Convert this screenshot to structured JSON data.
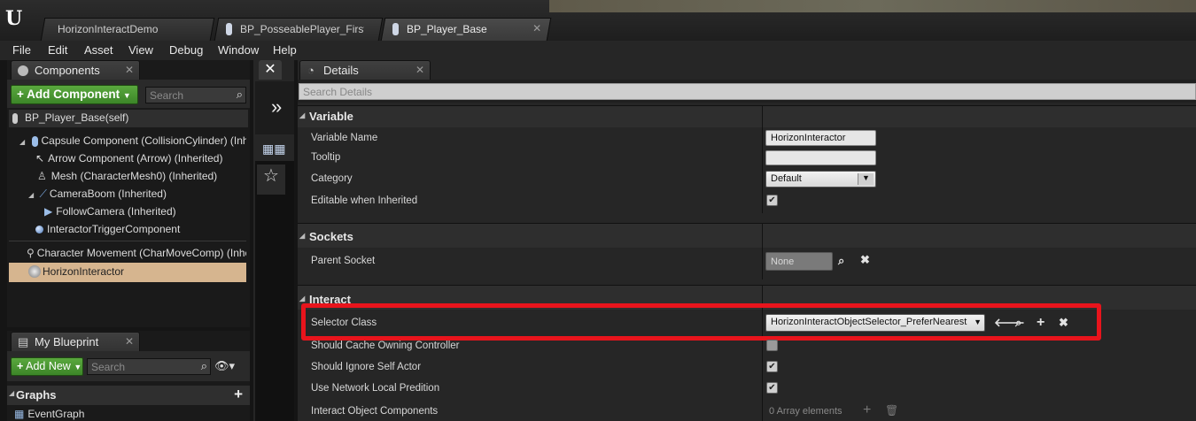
{
  "tabs": [
    {
      "label": "HorizonInteractDemo",
      "close": "✕"
    },
    {
      "label": "BP_PosseablePlayer_First",
      "close": "✕"
    },
    {
      "label": "BP_Player_Base",
      "close": "✕"
    }
  ],
  "menu": [
    "File",
    "Edit",
    "Asset",
    "View",
    "Debug",
    "Window",
    "Help"
  ],
  "components_panel": {
    "title": "Components",
    "close": "✕",
    "add_button": "Add Component",
    "search_placeholder": "Search",
    "self_label": "BP_Player_Base(self)",
    "items": [
      "Capsule Component (CollisionCylinder) (Inherited)",
      "Arrow Component (Arrow) (Inherited)",
      "Mesh (CharacterMesh0) (Inherited)",
      "CameraBoom (Inherited)",
      "FollowCamera (Inherited)",
      "InteractorTriggerComponent",
      "Character Movement (CharMoveComp) (Inherited)",
      "HorizonInteractor"
    ]
  },
  "blueprint_panel": {
    "title": "My Blueprint",
    "close": "✕",
    "add_button": "Add New",
    "search_placeholder": "Search",
    "graphs_label": "Graphs",
    "graph_item": "EventGraph"
  },
  "details": {
    "title": "Details",
    "close": "✕",
    "search_placeholder": "Search Details",
    "sections": {
      "variable": "Variable",
      "sockets": "Sockets",
      "interact": "Interact"
    },
    "variable_name_label": "Variable Name",
    "variable_name_value": "HorizonInteractor",
    "tooltip_label": "Tooltip",
    "tooltip_value": "",
    "category_label": "Category",
    "category_value": "Default",
    "editable_label": "Editable when Inherited",
    "editable_checked": true,
    "parent_socket_label": "Parent Socket",
    "parent_socket_value": "None",
    "selector_class_label": "Selector Class",
    "selector_class_value": "HorizonInteractObjectSelector_PreferNearest",
    "cache_owning_label": "Should Cache Owning Controller",
    "cache_owning_checked": false,
    "ignore_self_label": "Should Ignore Self Actor",
    "ignore_self_checked": true,
    "network_local_label": "Use Network Local Predition",
    "network_local_checked": true,
    "object_components_label": "Interact Object Components",
    "object_components_value": "0 Array elements"
  },
  "colors": {
    "highlight": "#e8141c",
    "selected_row": "#d6b58f",
    "add_button": "#4a9a33"
  }
}
